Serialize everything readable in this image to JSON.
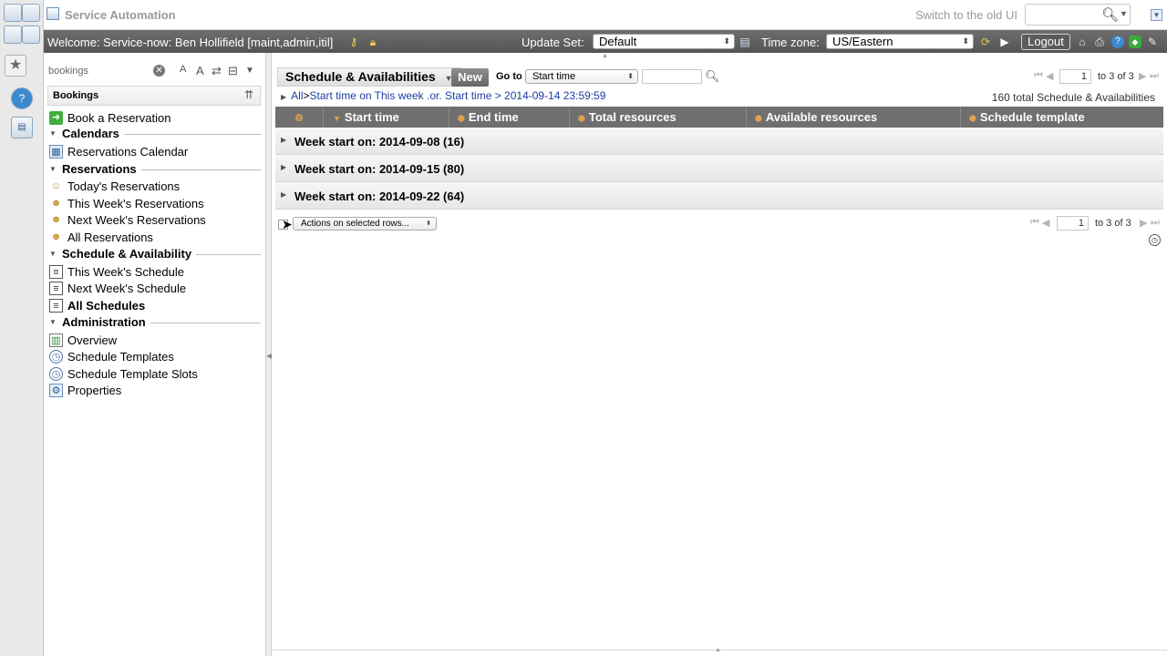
{
  "app": {
    "title": "Service Automation",
    "switch_ui_label": "Switch to the old UI",
    "search_placeholder": ""
  },
  "banner": {
    "welcome": "Welcome: Service-now: Ben Hollifield [maint,admin,itil]",
    "update_set_label": "Update Set:",
    "update_set_value": "Default",
    "timezone_label": "Time zone:",
    "timezone_value": "US/Eastern",
    "logout_label": "Logout"
  },
  "nav": {
    "filter_value": "bookings",
    "header": "Bookings",
    "top_items": [
      {
        "label": "Book a Reservation",
        "icon": "book-arrow-icon"
      }
    ],
    "sections": [
      {
        "label": "Calendars",
        "items": [
          {
            "label": "Reservations Calendar",
            "icon": "calendar-icon"
          }
        ]
      },
      {
        "label": "Reservations",
        "items": [
          {
            "label": "Today's Reservations",
            "icon": "person-icon"
          },
          {
            "label": "This Week's Reservations",
            "icon": "people-icon"
          },
          {
            "label": "Next Week's Reservations",
            "icon": "people-icon"
          },
          {
            "label": "All Reservations",
            "icon": "people-icon"
          }
        ]
      },
      {
        "label": "Schedule & Availability",
        "items": [
          {
            "label": "This Week's Schedule",
            "icon": "list-icon"
          },
          {
            "label": "Next Week's Schedule",
            "icon": "list-icon"
          },
          {
            "label": "All Schedules",
            "icon": "list-icon",
            "bold": true
          }
        ]
      },
      {
        "label": "Administration",
        "items": [
          {
            "label": "Overview",
            "icon": "chart-icon"
          },
          {
            "label": "Schedule Templates",
            "icon": "clock-icon"
          },
          {
            "label": "Schedule Template Slots",
            "icon": "clock-icon"
          },
          {
            "label": "Properties",
            "icon": "properties-icon"
          }
        ]
      }
    ]
  },
  "list": {
    "title": "Schedule & Availabilities",
    "new_label": "New",
    "goto_label": "Go to",
    "goto_field": "Start time",
    "goto_value": "",
    "page_current": "1",
    "page_of": "to 3 of 3",
    "breadcrumb_all": "All",
    "breadcrumb_sep": ">",
    "breadcrumb_filter": "Start time on This week .or. Start time > 2014-09-14 23:59:59",
    "total_count": "160 total Schedule & Availabilities",
    "columns": [
      "Start time",
      "End time",
      "Total resources",
      "Available resources",
      "Schedule template"
    ],
    "groups": [
      "Week start on: 2014-09-08 (16)",
      "Week start on: 2014-09-15 (80)",
      "Week start on: 2014-09-22 (64)"
    ],
    "actions_label": "Actions on selected rows...",
    "bottom_page_current": "1",
    "bottom_page_of": "to 3 of 3"
  },
  "colors": {
    "banner_bg": "#5f5f5f",
    "grid_header_bg": "#6f6f6f",
    "link": "#1a3fa0",
    "new_button": "#777777"
  }
}
